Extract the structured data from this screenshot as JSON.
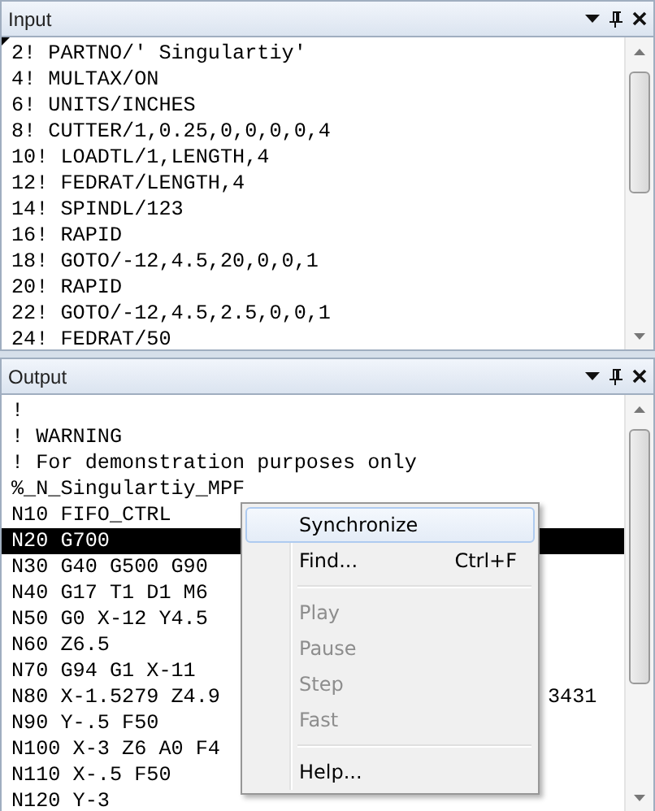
{
  "panels": [
    {
      "title": "Input",
      "lines": [
        {
          "text": "2! PARTNO/' Singulartiy'",
          "selected": false
        },
        {
          "text": "4! MULTAX/ON",
          "selected": false
        },
        {
          "text": "6! UNITS/INCHES",
          "selected": false
        },
        {
          "text": "8! CUTTER/1,0.25,0,0,0,0,4",
          "selected": false
        },
        {
          "text": "10! LOADTL/1,LENGTH,4",
          "selected": false
        },
        {
          "text": "12! FEDRAT/LENGTH,4",
          "selected": false
        },
        {
          "text": "14! SPINDL/123",
          "selected": false
        },
        {
          "text": "16! RAPID",
          "selected": false
        },
        {
          "text": "18! GOTO/-12,4.5,20,0,0,1",
          "selected": false
        },
        {
          "text": "20! RAPID",
          "selected": false
        },
        {
          "text": "22! GOTO/-12,4.5,2.5,0,0,1",
          "selected": false
        },
        {
          "text": "24! FEDRAT/50",
          "selected": false
        }
      ]
    },
    {
      "title": "Output",
      "lines": [
        {
          "text": "!",
          "selected": false
        },
        {
          "text": "! WARNING",
          "selected": false
        },
        {
          "text": "! For demonstration purposes only",
          "selected": false
        },
        {
          "text": "%_N_Singulartiy_MPF",
          "selected": false
        },
        {
          "text": "N10 FIFO_CTRL",
          "selected": false
        },
        {
          "text": "N20 G700",
          "selected": true
        },
        {
          "text": "N30 G40 G500 G90",
          "selected": false
        },
        {
          "text": "N40 G17 T1 D1 M6",
          "selected": false
        },
        {
          "text": "N50 G0 X-12 Y4.5",
          "selected": false
        },
        {
          "text": "N60 Z6.5",
          "selected": false
        },
        {
          "text": "N70 G94 G1 X-11",
          "selected": false
        },
        {
          "text": "N80 X-1.5279 Z4.9",
          "tail": "3431",
          "selected": false
        },
        {
          "text": "N90 Y-.5 F50",
          "selected": false
        },
        {
          "text": "N100 X-3 Z6 A0 F4",
          "selected": false
        },
        {
          "text": "N110 X-.5 F50",
          "selected": false
        },
        {
          "text": "N120 Y-3",
          "selected": false
        }
      ]
    }
  ],
  "context_menu": [
    {
      "kind": "item",
      "label": "Synchronize",
      "selected": true,
      "disabled": false
    },
    {
      "kind": "item",
      "label": "Find...",
      "shortcut": "Ctrl+F",
      "selected": false,
      "disabled": false
    },
    {
      "kind": "separator"
    },
    {
      "kind": "item",
      "label": "Play",
      "selected": false,
      "disabled": true
    },
    {
      "kind": "item",
      "label": "Pause",
      "selected": false,
      "disabled": true
    },
    {
      "kind": "item",
      "label": "Step",
      "selected": false,
      "disabled": true
    },
    {
      "kind": "item",
      "label": "Fast",
      "selected": false,
      "disabled": true
    },
    {
      "kind": "separator"
    },
    {
      "kind": "item",
      "label": "Help...",
      "selected": false,
      "disabled": false
    }
  ]
}
